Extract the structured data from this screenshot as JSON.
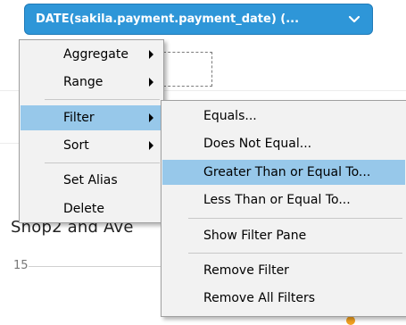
{
  "field_pill": {
    "label": "DATE(sakila.payment.payment_date) (..."
  },
  "background": {
    "worksheet_text": "Shop2 and Ave",
    "axis_tick": "15"
  },
  "menu": {
    "items": [
      {
        "label": "Aggregate"
      },
      {
        "label": "Range"
      },
      {
        "label": "Filter"
      },
      {
        "label": "Sort"
      },
      {
        "label": "Set Alias"
      },
      {
        "label": "Delete"
      }
    ]
  },
  "submenu": {
    "items": [
      {
        "label": "Equals..."
      },
      {
        "label": "Does Not Equal..."
      },
      {
        "label": "Greater Than or Equal To..."
      },
      {
        "label": "Less Than or Equal To..."
      },
      {
        "label": "Show Filter Pane"
      },
      {
        "label": "Remove Filter"
      },
      {
        "label": "Remove All Filters"
      }
    ]
  },
  "colors": {
    "pill": "#2e96d8",
    "highlight": "#97c8ea",
    "menu_bg": "#f2f2f2"
  }
}
